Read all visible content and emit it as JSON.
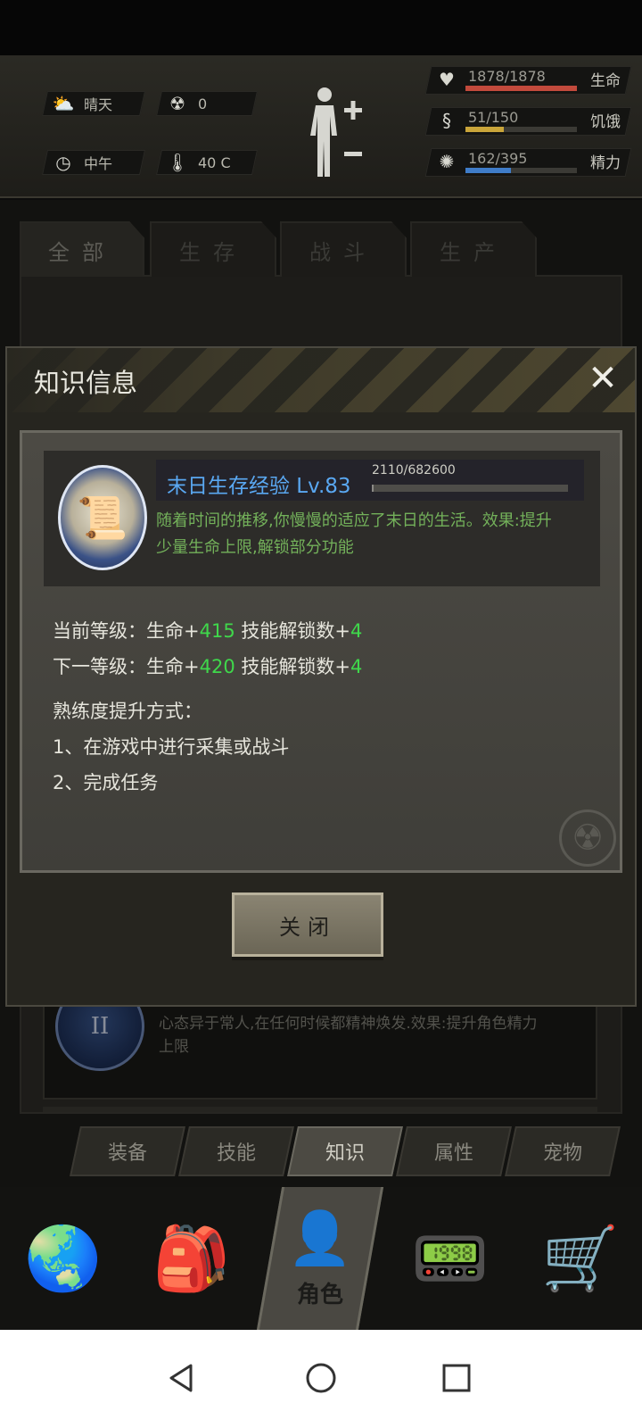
{
  "hud": {
    "weather": "晴天",
    "radiation": "0",
    "time": "中午",
    "temperature": "40 C",
    "stats": [
      {
        "icon": "heart-icon",
        "value": "1878/1878",
        "label": "生命",
        "fraction": 1.0,
        "color": "#c24a3c"
      },
      {
        "icon": "stomach-icon",
        "value": "51/150",
        "label": "饥饿",
        "fraction": 0.34,
        "color": "#c9a53a"
      },
      {
        "icon": "brain-icon",
        "value": "162/395",
        "label": "精力",
        "fraction": 0.41,
        "color": "#3f7cc8"
      }
    ]
  },
  "tabs": [
    "全部",
    "生存",
    "战斗",
    "生产"
  ],
  "background_card": {
    "badge": "II",
    "description": "心态异于常人,在任何时候都精神焕发.效果:提升角色精力上限"
  },
  "dialog": {
    "title": "知识信息",
    "close_symbol": "✕",
    "skill": {
      "name": "末日生存经验 Lv.83",
      "exp": "2110/682600",
      "exp_fraction": 0.003,
      "description": "随着时间的推移,你慢慢的适应了末日的生活。效果:提升少量生命上限,解锁部分功能"
    },
    "current_level": {
      "prefix": "当前等级：生命+",
      "hp": "415",
      "mid": " 技能解锁数+",
      "unlock": "4"
    },
    "next_level": {
      "prefix": "下一等级：生命+",
      "hp": "420",
      "mid": " 技能解锁数+",
      "unlock": "4"
    },
    "method_title": "熟练度提升方式：",
    "methods": [
      "1、在游戏中进行采集或战斗",
      "2、完成任务"
    ],
    "close_button": "关闭"
  },
  "subtabs": [
    "装备",
    "技能",
    "知识",
    "属性",
    "宠物"
  ],
  "active_subtab": "知识",
  "nav": {
    "role_label": "角色"
  }
}
